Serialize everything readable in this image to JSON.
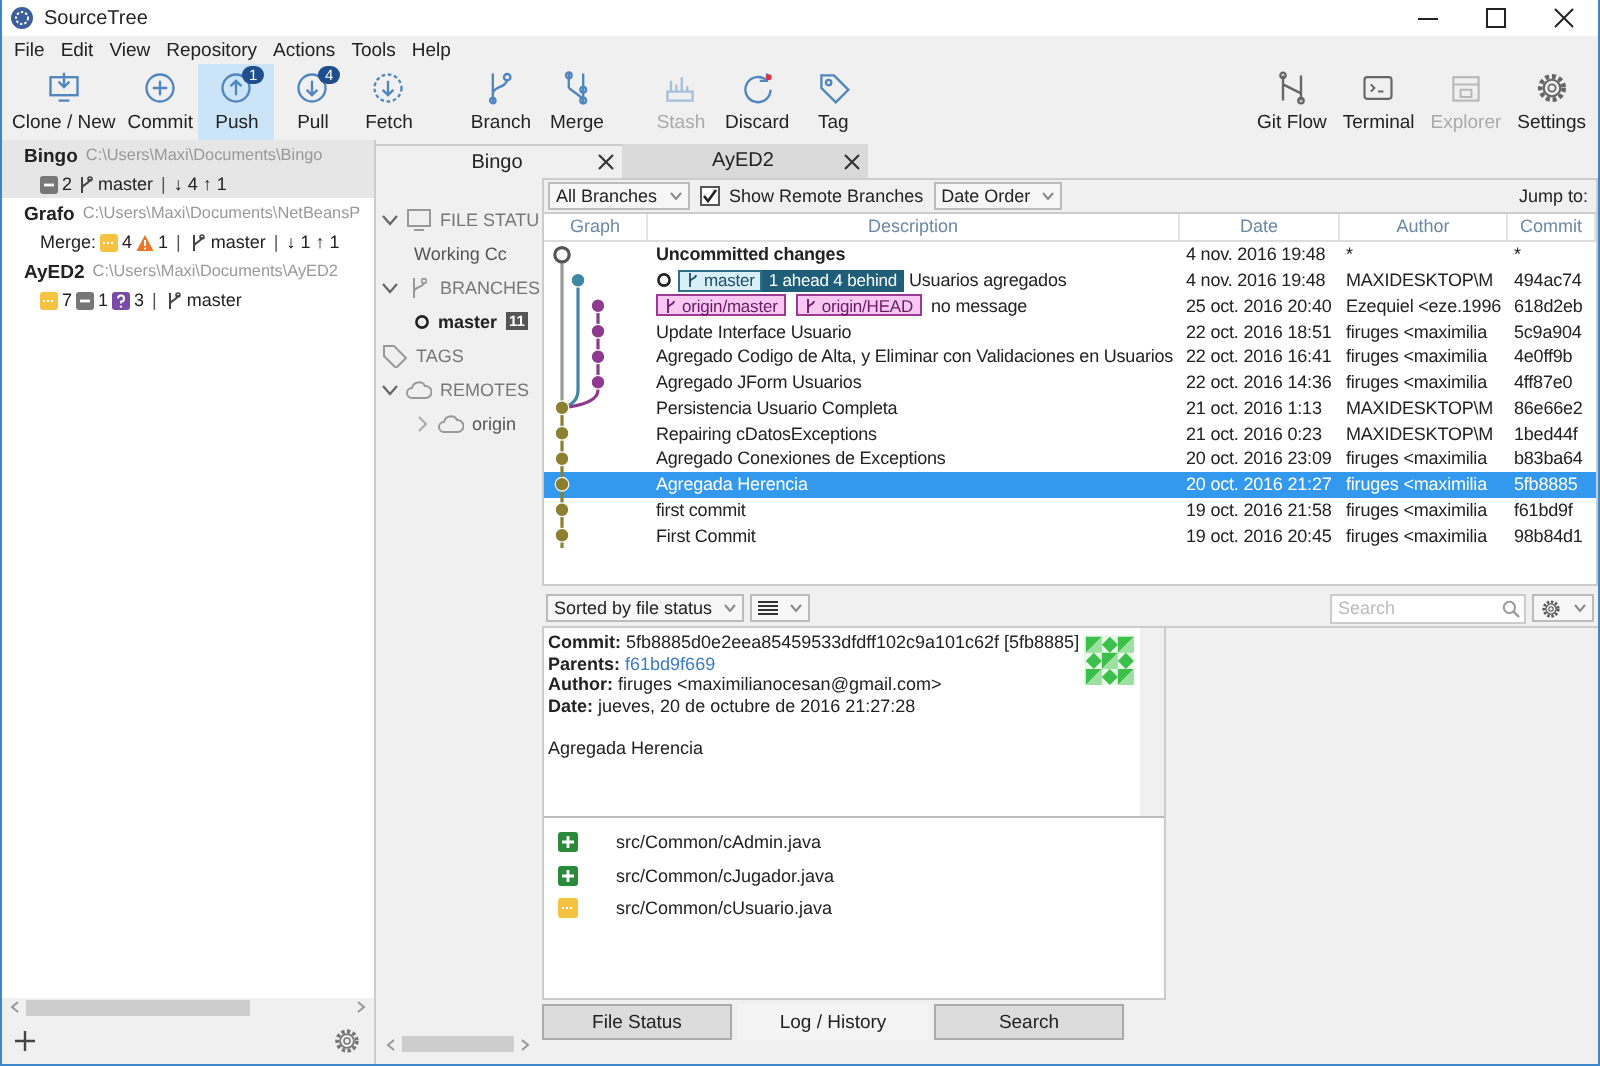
{
  "window": {
    "title": "SourceTree"
  },
  "menu": [
    "File",
    "Edit",
    "View",
    "Repository",
    "Actions",
    "Tools",
    "Help"
  ],
  "toolbar": {
    "left": [
      {
        "label": "Clone / New",
        "selected": false,
        "disabled": false
      },
      {
        "label": "Commit",
        "selected": false,
        "disabled": false
      },
      {
        "label": "Push",
        "selected": true,
        "disabled": false,
        "badge": "1"
      },
      {
        "label": "Pull",
        "selected": false,
        "disabled": false,
        "badge": "4"
      },
      {
        "label": "Fetch",
        "selected": false,
        "disabled": false
      },
      {
        "label": "Branch",
        "selected": false,
        "disabled": false
      },
      {
        "label": "Merge",
        "selected": false,
        "disabled": false
      },
      {
        "label": "Stash",
        "selected": false,
        "disabled": true
      },
      {
        "label": "Discard",
        "selected": false,
        "disabled": false
      },
      {
        "label": "Tag",
        "selected": false,
        "disabled": false
      }
    ],
    "right": [
      {
        "label": "Git Flow",
        "selected": false,
        "disabled": false
      },
      {
        "label": "Terminal",
        "selected": false,
        "disabled": false
      },
      {
        "label": "Explorer",
        "selected": false,
        "disabled": true
      },
      {
        "label": "Settings",
        "selected": false,
        "disabled": false
      }
    ]
  },
  "repos": [
    {
      "name": "Bingo",
      "path": "C:\\Users\\Maxi\\Documents\\Bingo",
      "selected": true,
      "status": [
        {
          "kind": "missing",
          "text": "2"
        },
        {
          "kind": "branch",
          "text": "master"
        },
        {
          "kind": "sep",
          "text": "|"
        },
        {
          "kind": "sync",
          "text": "↓ 4 ↑ 1"
        }
      ]
    },
    {
      "name": "Grafo",
      "path": "C:\\Users\\Maxi\\Documents\\NetBeansP",
      "selected": false,
      "status": [
        {
          "kind": "label",
          "text": "Merge:"
        },
        {
          "kind": "pending",
          "text": "4"
        },
        {
          "kind": "warning",
          "text": "1"
        },
        {
          "kind": "sep",
          "text": "|"
        },
        {
          "kind": "branch",
          "text": "master"
        },
        {
          "kind": "sep",
          "text": "|"
        },
        {
          "kind": "sync",
          "text": "↓ 1 ↑ 1"
        }
      ]
    },
    {
      "name": "AyED2",
      "path": "C:\\Users\\Maxi\\Documents\\AyED2",
      "selected": false,
      "status": [
        {
          "kind": "pending",
          "text": "7"
        },
        {
          "kind": "missing",
          "text": "1"
        },
        {
          "kind": "untracked",
          "text": "3"
        },
        {
          "kind": "sep",
          "text": "|"
        },
        {
          "kind": "branch",
          "text": "master"
        }
      ]
    }
  ],
  "tabs": [
    {
      "label": "Bingo",
      "selected": true
    },
    {
      "label": "AyED2",
      "selected": false
    }
  ],
  "sidebar": [
    {
      "label": "FILE STATU",
      "expanded": true,
      "children": [
        {
          "label": "Working Cc",
          "current": false
        }
      ]
    },
    {
      "label": "BRANCHES",
      "expanded": true,
      "children": [
        {
          "label": "master",
          "current": true,
          "badge": "11"
        }
      ]
    },
    {
      "label": "TAGS",
      "expanded": false
    },
    {
      "label": "REMOTES",
      "expanded": true,
      "children": [
        {
          "label": "origin",
          "current": false,
          "expanded": false
        }
      ]
    }
  ],
  "log": {
    "filters": {
      "branches": "All Branches",
      "show_remote": {
        "label": "Show Remote Branches",
        "checked": true
      },
      "order": "Date Order",
      "jump": "Jump to:"
    },
    "columns": [
      "Graph",
      "Description",
      "Date",
      "Author",
      "Commit"
    ],
    "rows": [
      {
        "kind": "uncommitted",
        "head": false,
        "description": "Uncommitted changes",
        "date": "4 nov. 2016 19:48",
        "author": "*",
        "commit": "*",
        "selected": false,
        "refs": []
      },
      {
        "kind": "local",
        "head": true,
        "description": "Usuarios agregados",
        "date": "4 nov. 2016 19:48",
        "author": "MAXIDESKTOP\\M",
        "commit": "494ac74",
        "selected": false,
        "refs": [
          {
            "kind": "local",
            "text": "master",
            "tracking": "1 ahead 4 behind"
          }
        ]
      },
      {
        "kind": "remote",
        "head": false,
        "description": "no message",
        "date": "25 oct. 2016 20:40",
        "author": "Ezequiel <eze.1996",
        "commit": "618d2eb",
        "selected": false,
        "refs": [
          {
            "kind": "remote",
            "text": "origin/master"
          },
          {
            "kind": "remote",
            "text": "origin/HEAD"
          }
        ]
      },
      {
        "kind": "remote",
        "head": false,
        "description": "Update Interface Usuario",
        "date": "22 oct. 2016 18:51",
        "author": "firuges <maximilia",
        "commit": "5c9a904",
        "selected": false,
        "refs": []
      },
      {
        "kind": "remote",
        "head": false,
        "description": "Agregado Codigo de Alta, y Eliminar con Validaciones en Usuarios",
        "date": "22 oct. 2016 16:41",
        "author": "firuges <maximilia",
        "commit": "4e0ff9b",
        "selected": false,
        "refs": []
      },
      {
        "kind": "remote",
        "head": false,
        "description": "Agregado JForm Usuarios",
        "date": "22 oct. 2016 14:36",
        "author": "firuges <maximilia",
        "commit": "4ff87e0",
        "selected": false,
        "refs": []
      },
      {
        "kind": "main",
        "head": false,
        "description": "Persistencia Usuario Completa",
        "date": "21 oct. 2016 1:13",
        "author": "MAXIDESKTOP\\M",
        "commit": "86e66e2",
        "selected": false,
        "refs": []
      },
      {
        "kind": "main",
        "head": false,
        "description": "Repairing cDatosExceptions",
        "date": "21 oct. 2016 0:23",
        "author": "MAXIDESKTOP\\M",
        "commit": "1bed44f",
        "selected": false,
        "refs": []
      },
      {
        "kind": "main",
        "head": false,
        "description": "Agregado Conexiones de Exceptions",
        "date": "20 oct. 2016 23:09",
        "author": "firuges <maximilia",
        "commit": "b83ba64",
        "selected": false,
        "refs": []
      },
      {
        "kind": "main",
        "head": false,
        "description": "Agregada Herencia",
        "date": "20 oct. 2016 21:27",
        "author": "firuges <maximilia",
        "commit": "5fb8885",
        "selected": true,
        "refs": []
      },
      {
        "kind": "main",
        "head": false,
        "description": "first commit",
        "date": "19 oct. 2016 21:58",
        "author": "firuges <maximilia",
        "commit": "f61bd9f",
        "selected": false,
        "refs": []
      },
      {
        "kind": "main",
        "head": false,
        "description": "First Commit",
        "date": "19 oct. 2016 20:45",
        "author": "firuges <maximilia",
        "commit": "98b84d1",
        "selected": false,
        "refs": []
      }
    ]
  },
  "details": {
    "sort": "Sorted by file status",
    "search": {
      "placeholder": "Search"
    },
    "fields": [
      {
        "label": "Commit:",
        "value": "5fb8885d0e2eea85459533dfdff102c9a101c62f [5fb8885]",
        "kind": "text"
      },
      {
        "label": "Parents:",
        "value": "f61bd9f669",
        "kind": "link"
      },
      {
        "label": "Author:",
        "value": "firuges <maximilianocesan@gmail.com>",
        "kind": "text"
      },
      {
        "label": "Date:",
        "value": "jueves, 20 de octubre de 2016 21:27:28",
        "kind": "text"
      }
    ],
    "message": "Agregada Herencia",
    "files": [
      {
        "kind": "added",
        "path": "src/Common/cAdmin.java"
      },
      {
        "kind": "added",
        "path": "src/Common/cJugador.java"
      },
      {
        "kind": "modified",
        "path": "src/Common/cUsuario.java"
      }
    ]
  },
  "bottom_tabs": [
    {
      "label": "File Status",
      "selected": false
    },
    {
      "label": "Log / History",
      "selected": true
    },
    {
      "label": "Search",
      "selected": false
    }
  ]
}
